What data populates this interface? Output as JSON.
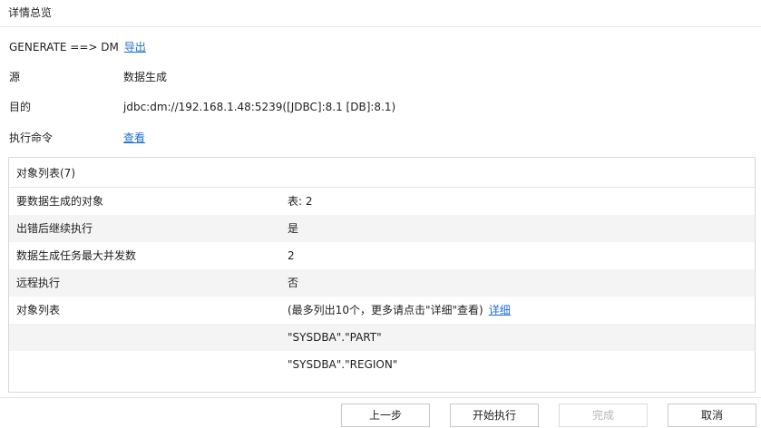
{
  "header": {
    "title": "详情总览"
  },
  "summary": {
    "direction_text": "GENERATE ==> DM",
    "export_link": "导出",
    "source_label": "源",
    "source_value": "数据生成",
    "target_label": "目的",
    "target_value": "jdbc:dm://192.168.1.48:5239([JDBC]:8.1 [DB]:8.1)",
    "command_label": "执行命令",
    "command_link": "查看"
  },
  "panel": {
    "title": "对象列表(7)",
    "rows": [
      {
        "key": "要数据生成的对象",
        "value": "表: 2"
      },
      {
        "key": "出错后继续执行",
        "value": "是"
      },
      {
        "key": "数据生成任务最大并发数",
        "value": "2"
      },
      {
        "key": "远程执行",
        "value": "否"
      },
      {
        "key": "对象列表",
        "value": "(最多列出10个，更多请点击\"详细\"查看)",
        "link": "详细"
      },
      {
        "key": "",
        "value": "\"SYSDBA\".\"PART\""
      },
      {
        "key": "",
        "value": "\"SYSDBA\".\"REGION\""
      }
    ]
  },
  "footer": {
    "prev_label": "上一步",
    "start_label": "开始执行",
    "finish_label": "完成",
    "cancel_label": "取消"
  }
}
